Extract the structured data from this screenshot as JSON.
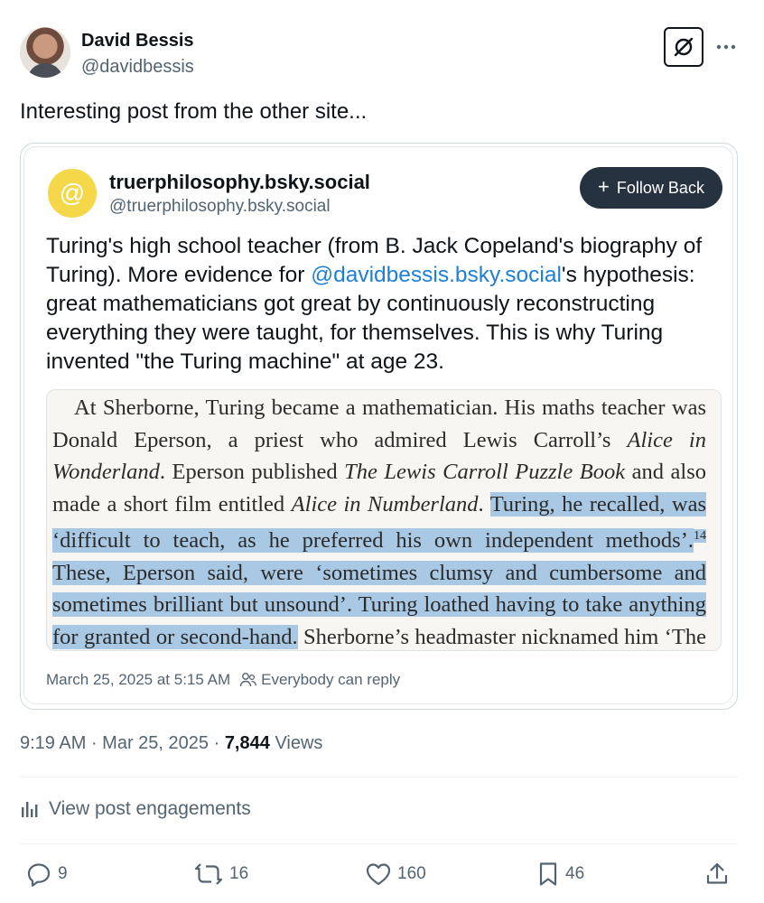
{
  "author": {
    "name": "David Bessis",
    "handle": "@davidbessis"
  },
  "post": {
    "text": "Interesting post from the other site..."
  },
  "quoted": {
    "avatar_glyph": "@",
    "name": "truerphilosophy.bsky.social",
    "handle": "@truerphilosophy.bsky.social",
    "follow_label": "Follow Back",
    "text_before": "Turing's high school teacher (from B. Jack Copeland's biography of Turing). More evidence for ",
    "mention": "@davidbessis.bsky.social",
    "text_after": "'s hypothesis: great mathematicians got great by continuously reconstructing everything they were taught, for themselves. This is why Turing invented \"the Turing machine\" at age 23.",
    "book_excerpt": {
      "p1": "At Sherborne, Turing became a mathematician. His maths teacher was Donald Eperson, a priest who admired Lewis Carroll’s ",
      "i1": "Alice in Wonderland",
      "p2": ". Eperson published ",
      "i2": "The Lewis Carroll Puzzle Book",
      "p3": " and also made a short film entitled ",
      "i3": "Alice in Numberland",
      "p4": ". ",
      "h1": "Turing, he recalled, was ‘difficult to teach, as he preferred his own independent methods’.",
      "footnote": "14",
      "h2": " These, Eperson said, were ‘sometimes clumsy and cumbersome and sometimes brilliant but unsound’. Turing loathed having to take anything for granted or second-hand.",
      "p5": " Sherborne’s headmaster nicknamed him ‘The Alchemist’ and"
    },
    "timestamp": "March 25, 2025 at 5:15 AM",
    "reply_setting": "Everybody can reply"
  },
  "meta": {
    "time": "9:19 AM",
    "date": "Mar 25, 2025",
    "views_count": "7,844",
    "views_label": "Views"
  },
  "engagements_label": "View post engagements",
  "actions": {
    "replies": "9",
    "reposts": "16",
    "likes": "160",
    "bookmarks": "46"
  },
  "colors": {
    "text": "#0f1419",
    "secondary": "#536471",
    "mention": "#1d7fd6",
    "highlight": "#a8c8e3",
    "follow_button": "#273240",
    "bsky_avatar": "#f4d84a"
  }
}
